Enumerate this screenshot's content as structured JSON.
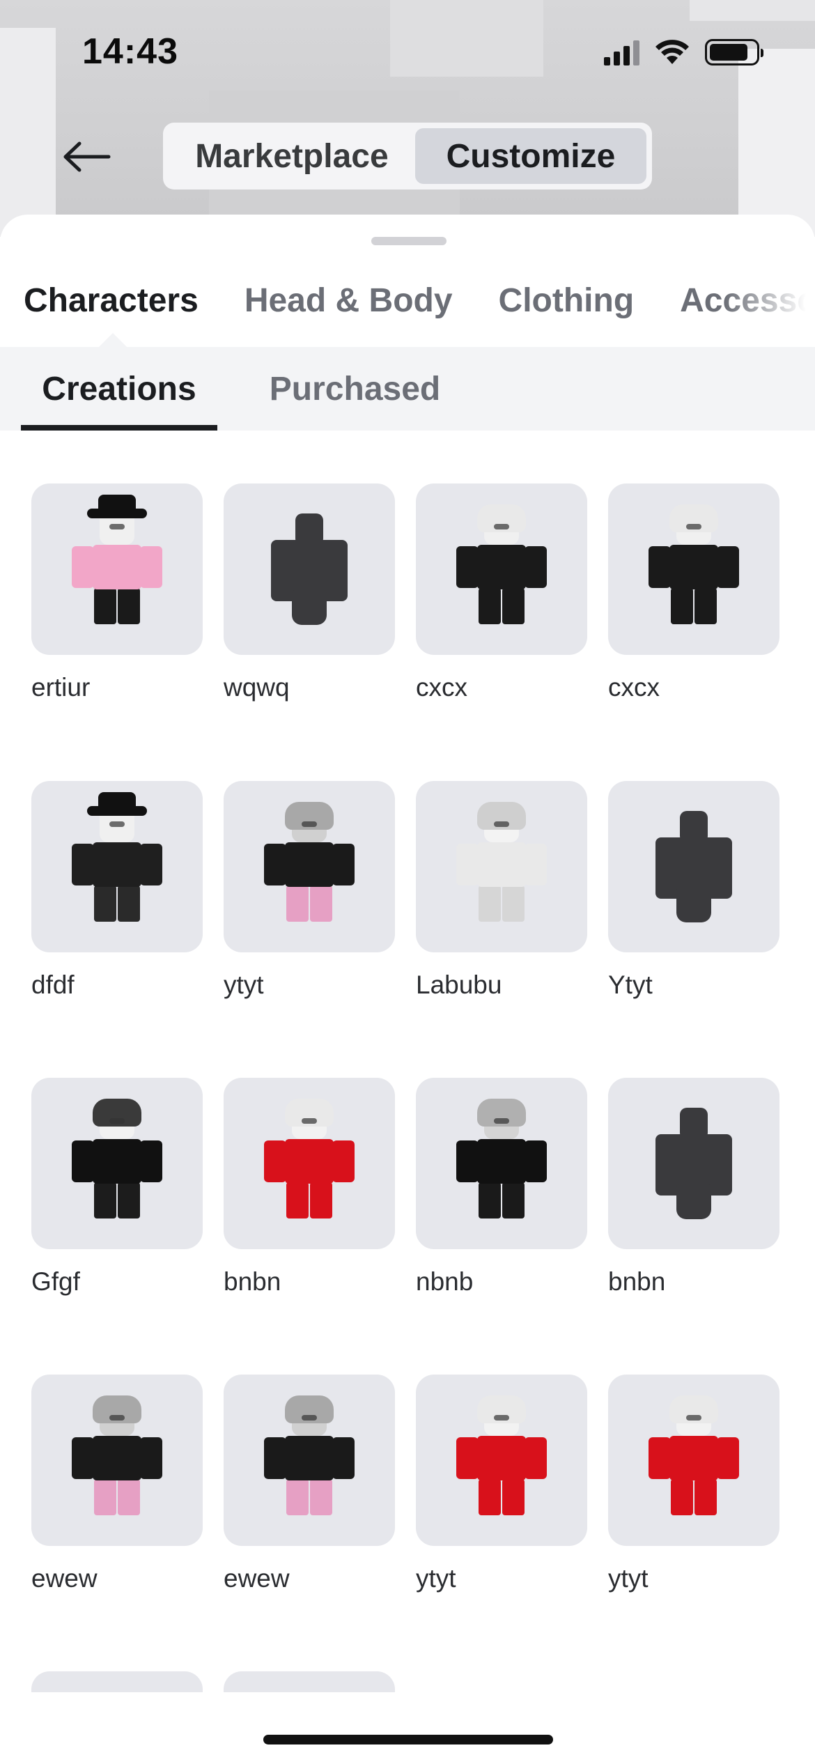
{
  "status_bar": {
    "time": "14:43"
  },
  "top_nav": {
    "segments": [
      {
        "label": "Marketplace",
        "selected": false
      },
      {
        "label": "Customize",
        "selected": true
      }
    ]
  },
  "category_tabs": [
    {
      "label": "Characters",
      "active": true
    },
    {
      "label": "Head & Body",
      "active": false
    },
    {
      "label": "Clothing",
      "active": false
    },
    {
      "label": "Accessor",
      "active": false
    }
  ],
  "sub_tabs": [
    {
      "label": "Creations",
      "active": true
    },
    {
      "label": "Purchased",
      "active": false
    }
  ],
  "characters": [
    {
      "name": "ertiur",
      "style": "pink-hat"
    },
    {
      "name": "wqwq",
      "style": "blank"
    },
    {
      "name": "cxcx",
      "style": "white-hair-black"
    },
    {
      "name": "cxcx",
      "style": "white-hair-black"
    },
    {
      "name": "dfdf",
      "style": "hat-black"
    },
    {
      "name": "ytyt",
      "style": "gray-black-pink"
    },
    {
      "name": "Labubu",
      "style": "white-all"
    },
    {
      "name": "Ytyt",
      "style": "blank"
    },
    {
      "name": "Gfgf",
      "style": "black-star"
    },
    {
      "name": "bnbn",
      "style": "red"
    },
    {
      "name": "nbnb",
      "style": "gray-black"
    },
    {
      "name": "bnbn",
      "style": "blank"
    },
    {
      "name": "ewew",
      "style": "gray-black-pink"
    },
    {
      "name": "ewew",
      "style": "gray-black-pink"
    },
    {
      "name": "ytyt",
      "style": "red"
    },
    {
      "name": "ytyt",
      "style": "red"
    }
  ],
  "colors": {
    "tile_bg": "#e6e7ec",
    "tab_active": "#1b1d20",
    "tab_inactive": "#6b6e76",
    "segment_selected": "#d4d6dc"
  }
}
